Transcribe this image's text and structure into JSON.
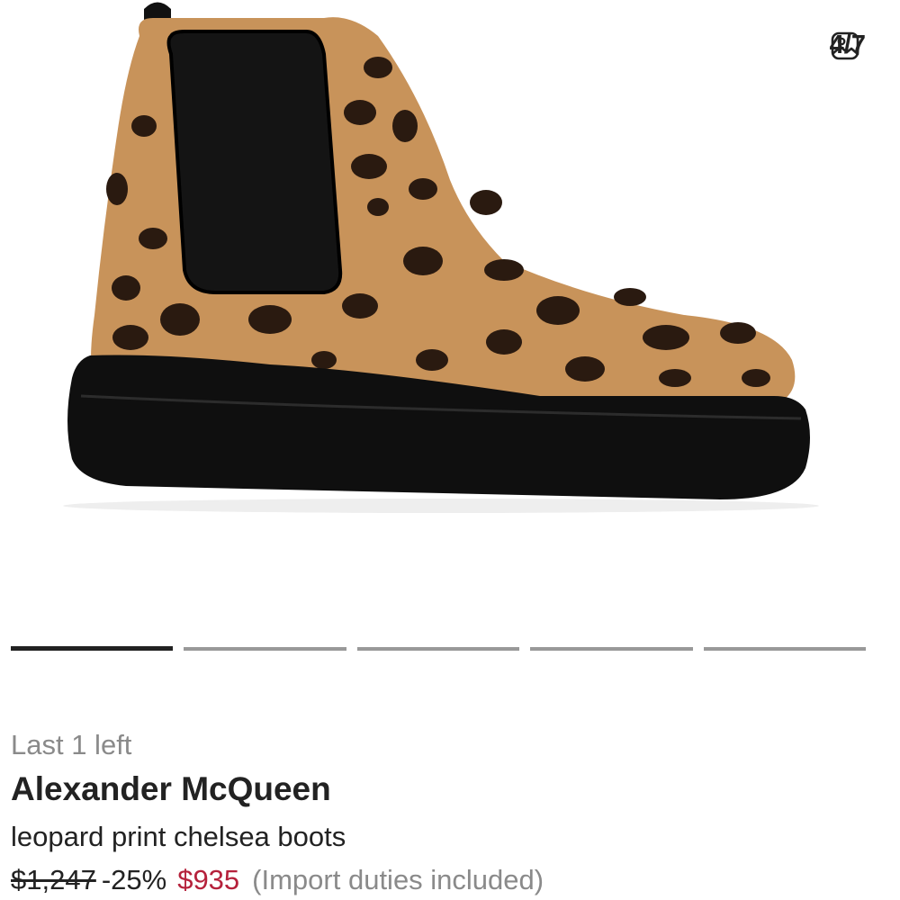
{
  "gallery": {
    "image_alt": "Leopard print chelsea boot with black chunky sole",
    "counter_icon": "image-icon",
    "counter_text": "4/7",
    "pagination": {
      "total_segments": 5,
      "active_index": 0
    }
  },
  "product": {
    "stock_label": "Last 1 left",
    "brand": "Alexander McQueen",
    "description": "leopard print chelsea boots",
    "original_price": "$1,247",
    "discount": "-25%",
    "sale_price": "$935",
    "duty_note": "(Import duties included)"
  },
  "colors": {
    "sale": "#b5213b",
    "text": "#222222",
    "muted": "#8a8a8a",
    "indicator_active": "#222222",
    "indicator_inactive": "#999999"
  }
}
